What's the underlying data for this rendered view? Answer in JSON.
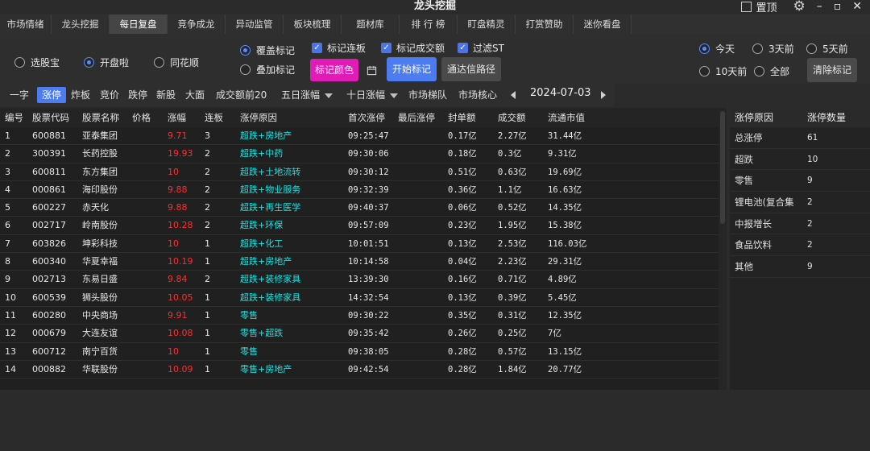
{
  "app": {
    "title": "龙头挖掘",
    "pin_label": "置顶"
  },
  "menu_tabs": [
    "市场情绪",
    "龙头挖掘",
    "每日复盘",
    "竞争成龙",
    "异动监管",
    "板块梳理",
    "题材库",
    "排 行 榜",
    "盯盘精灵",
    "打赏赞助",
    "迷你看盘"
  ],
  "source_radios": {
    "xuangubao": "选股宝",
    "kaipanla": "开盘啦",
    "tonghuashun": "同花顺"
  },
  "mark_mode": {
    "cover": "覆盖标记",
    "overlay": "叠加标记"
  },
  "checks": {
    "lianban": "标记连板",
    "chengjiao": "标记成交额",
    "filter_st": "过滤ST"
  },
  "buttons": {
    "mark_color": "标记颜色",
    "start_mark": "开始标记",
    "tdx_path": "通达信路径",
    "clear_mark": "清除标记"
  },
  "day_radios": {
    "today": "今天",
    "three": "3天前",
    "five": "5天前",
    "ten": "10天前",
    "all": "全部"
  },
  "filters": {
    "yizi": "一字",
    "zhangting": "涨停",
    "zhaban": "炸板",
    "jingjia": "竞价",
    "dieting": "跌停",
    "xingu": "新股",
    "damian": "大面",
    "top20": "成交额前20",
    "five_day": "五日涨幅",
    "ten_day": "十日涨幅",
    "tidui": "市场梯队",
    "hexin": "市场核心"
  },
  "date": "2024-07-03",
  "table": {
    "headers": [
      "编号",
      "股票代码",
      "股票名称",
      "价格",
      "涨幅",
      "连板",
      "涨停原因",
      "首次涨停",
      "最后涨停",
      "封单额",
      "成交额",
      "流通市值"
    ],
    "rows": [
      [
        "1",
        "600881",
        "亚泰集团",
        "",
        "9.71",
        "3",
        "超跌+房地产",
        "09:25:47",
        "",
        "0.17亿",
        "2.27亿",
        "31.44亿"
      ],
      [
        "2",
        "300391",
        "长药控股",
        "",
        "19.93",
        "2",
        "超跌+中药",
        "09:30:06",
        "",
        "0.18亿",
        "0.3亿",
        "9.31亿"
      ],
      [
        "3",
        "600811",
        "东方集团",
        "",
        "10",
        "2",
        "超跌+土地流转",
        "09:30:12",
        "",
        "0.51亿",
        "0.63亿",
        "19.69亿"
      ],
      [
        "4",
        "000861",
        "海印股份",
        "",
        "9.88",
        "2",
        "超跌+物业服务",
        "09:32:39",
        "",
        "0.36亿",
        "1.1亿",
        "16.63亿"
      ],
      [
        "5",
        "600227",
        "赤天化",
        "",
        "9.88",
        "2",
        "超跌+再生医学",
        "09:40:37",
        "",
        "0.06亿",
        "0.52亿",
        "14.35亿"
      ],
      [
        "6",
        "002717",
        "岭南股份",
        "",
        "10.28",
        "2",
        "超跌+环保",
        "09:57:09",
        "",
        "0.23亿",
        "1.95亿",
        "15.38亿"
      ],
      [
        "7",
        "603826",
        "坤彩科技",
        "",
        "10",
        "1",
        "超跌+化工",
        "10:01:51",
        "",
        "0.13亿",
        "2.53亿",
        "116.03亿"
      ],
      [
        "8",
        "600340",
        "华夏幸福",
        "",
        "10.19",
        "1",
        "超跌+房地产",
        "10:14:58",
        "",
        "0.04亿",
        "2.23亿",
        "29.31亿"
      ],
      [
        "9",
        "002713",
        "东易日盛",
        "",
        "9.84",
        "2",
        "超跌+装修家具",
        "13:39:30",
        "",
        "0.16亿",
        "0.71亿",
        "4.89亿"
      ],
      [
        "10",
        "600539",
        "狮头股份",
        "",
        "10.05",
        "1",
        "超跌+装修家具",
        "14:32:54",
        "",
        "0.13亿",
        "0.39亿",
        "5.45亿"
      ],
      [
        "11",
        "600280",
        "中央商场",
        "",
        "9.91",
        "1",
        "零售",
        "09:30:22",
        "",
        "0.35亿",
        "0.31亿",
        "12.35亿"
      ],
      [
        "12",
        "000679",
        "大连友谊",
        "",
        "10.08",
        "1",
        "零售+超跌",
        "09:35:42",
        "",
        "0.26亿",
        "0.25亿",
        "7亿"
      ],
      [
        "13",
        "600712",
        "南宁百货",
        "",
        "10",
        "1",
        "零售",
        "09:38:05",
        "",
        "0.28亿",
        "0.57亿",
        "13.15亿"
      ],
      [
        "14",
        "000882",
        "华联股份",
        "",
        "10.09",
        "1",
        "零售+房地产",
        "09:42:54",
        "",
        "0.28亿",
        "1.84亿",
        "20.77亿"
      ]
    ]
  },
  "reason_panel": {
    "headers": [
      "涨停原因",
      "涨停数量"
    ],
    "rows": [
      [
        "总涨停",
        "61"
      ],
      [
        "超跌",
        "10"
      ],
      [
        "零售",
        "9"
      ],
      [
        "锂电池(复合集",
        "2"
      ],
      [
        "中报增长",
        "2"
      ],
      [
        "食品饮料",
        "2"
      ],
      [
        "其他",
        "9"
      ]
    ]
  },
  "colors": {
    "accent": "#4c7cf0",
    "magenta": "#e01bb6",
    "rise": "#ff2f2f",
    "reason": "#18e3e3"
  }
}
